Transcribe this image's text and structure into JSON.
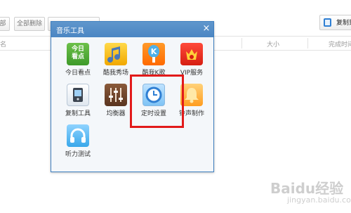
{
  "background": {
    "toolbar": {
      "button_partial_left": "部",
      "delete_all_label": "全部删除",
      "copy_button_label": "复制到"
    },
    "columns": {
      "name": "名",
      "size": "大小",
      "completed": "完成时间"
    }
  },
  "dialog": {
    "title": "音乐工具",
    "close_glyph": "×",
    "tools": [
      {
        "label": "今日看点",
        "icon_text": "今日\n看点",
        "icon": "news-icon"
      },
      {
        "label": "酷我秀场",
        "icon": "music-note-icon"
      },
      {
        "label": "酷我K歌",
        "icon_text": "K",
        "icon": "karaoke-mic-icon"
      },
      {
        "label": "VIP服务",
        "icon": "vip-crown-icon"
      },
      {
        "label": "复制工具",
        "icon": "copy-device-icon"
      },
      {
        "label": "均衡器",
        "icon": "equalizer-icon"
      },
      {
        "label": "定时设置",
        "icon": "clock-icon"
      },
      {
        "label": "铃声制作",
        "icon": "bell-icon"
      },
      {
        "label": "听力测试",
        "icon": "headphones-icon"
      }
    ],
    "highlighted_tool": "定时设置"
  },
  "colors": {
    "dialog_titlebar": "#4b86c3",
    "highlight": "#e21a1a"
  },
  "watermark": {
    "text": "Baidu经验",
    "sub": "jingyan.baidu.com"
  }
}
